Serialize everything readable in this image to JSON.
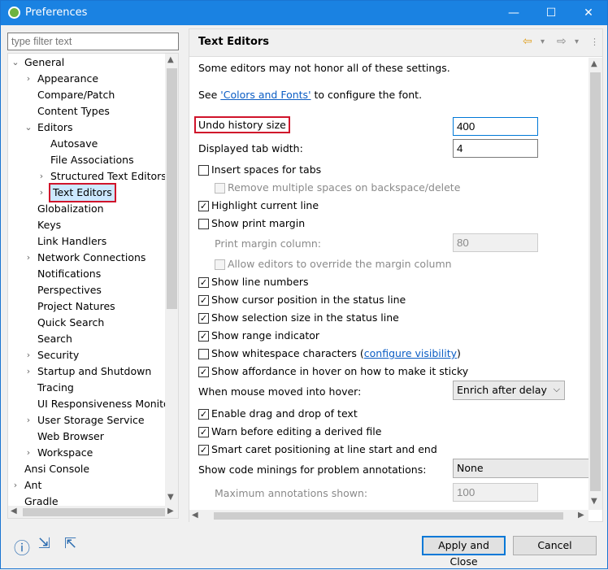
{
  "window": {
    "title": "Preferences",
    "minimize": "—",
    "maximize": "☐",
    "close": "✕"
  },
  "filter": {
    "placeholder": "type filter text"
  },
  "tree": {
    "items": [
      {
        "label": "General",
        "arrow": "⌄"
      },
      {
        "label": "Appearance",
        "arrow": "›"
      },
      {
        "label": "Compare/Patch",
        "arrow": ""
      },
      {
        "label": "Content Types",
        "arrow": ""
      },
      {
        "label": "Editors",
        "arrow": "⌄"
      },
      {
        "label": "Autosave",
        "arrow": ""
      },
      {
        "label": "File Associations",
        "arrow": ""
      },
      {
        "label": "Structured Text Editors",
        "arrow": "›"
      },
      {
        "label": "Text Editors",
        "arrow": "›"
      },
      {
        "label": "Globalization",
        "arrow": ""
      },
      {
        "label": "Keys",
        "arrow": ""
      },
      {
        "label": "Link Handlers",
        "arrow": ""
      },
      {
        "label": "Network Connections",
        "arrow": "›"
      },
      {
        "label": "Notifications",
        "arrow": ""
      },
      {
        "label": "Perspectives",
        "arrow": ""
      },
      {
        "label": "Project Natures",
        "arrow": ""
      },
      {
        "label": "Quick Search",
        "arrow": ""
      },
      {
        "label": "Search",
        "arrow": ""
      },
      {
        "label": "Security",
        "arrow": "›"
      },
      {
        "label": "Startup and Shutdown",
        "arrow": "›"
      },
      {
        "label": "Tracing",
        "arrow": ""
      },
      {
        "label": "UI Responsiveness Monitoring",
        "arrow": ""
      },
      {
        "label": "User Storage Service",
        "arrow": "›"
      },
      {
        "label": "Web Browser",
        "arrow": ""
      },
      {
        "label": "Workspace",
        "arrow": "›"
      },
      {
        "label": "Ansi Console",
        "arrow": ""
      },
      {
        "label": "Ant",
        "arrow": "›"
      },
      {
        "label": "Gradle",
        "arrow": ""
      }
    ]
  },
  "page": {
    "title": "Text Editors",
    "intro": "Some editors may not honor all of these settings.",
    "see_prefix": "See ",
    "see_link": "'Colors and Fonts'",
    "see_suffix": " to configure the font.",
    "undo_label": "Undo history size",
    "undo_value": "400",
    "tab_label": "Displayed tab width:",
    "tab_value": "4",
    "insert_spaces": "Insert spaces for tabs",
    "remove_spaces": "Remove multiple spaces on backspace/delete",
    "highlight_line": "Highlight current line",
    "show_print_margin": "Show print margin",
    "print_margin_col_label": "Print margin column:",
    "print_margin_col_value": "80",
    "allow_override": "Allow editors to override the margin column",
    "show_line_numbers": "Show line numbers",
    "show_cursor_pos": "Show cursor position in the status line",
    "show_selection_size": "Show selection size in the status line",
    "show_range": "Show range indicator",
    "show_whitespace": "Show whitespace characters (",
    "whitespace_link": "configure visibility",
    "whitespace_close": ")",
    "show_affordance": "Show affordance in hover on how to make it sticky",
    "hover_label": "When mouse moved into hover:",
    "hover_value": "Enrich after delay",
    "drag_drop": "Enable drag and drop of text",
    "warn_derived": "Warn before editing a derived file",
    "smart_caret": "Smart caret positioning at line start and end",
    "code_minings_label": "Show code minings for problem annotations:",
    "code_minings_value": "None",
    "max_annotations_label": "Maximum annotations shown:",
    "max_annotations_value": "100"
  },
  "checked": {
    "insert_spaces": false,
    "remove_spaces": false,
    "highlight_line": true,
    "show_print_margin": false,
    "allow_override": false,
    "show_line_numbers": true,
    "show_cursor_pos": true,
    "show_selection_size": true,
    "show_range": true,
    "show_whitespace": false,
    "show_affordance": true,
    "drag_drop": true,
    "warn_derived": true,
    "smart_caret": true
  },
  "buttons": {
    "apply_close": "Apply and Close",
    "cancel": "Cancel"
  },
  "colors": {
    "titlebar": "#1a82e2",
    "highlight_box": "#d0142b",
    "link": "#0b5dc4"
  }
}
